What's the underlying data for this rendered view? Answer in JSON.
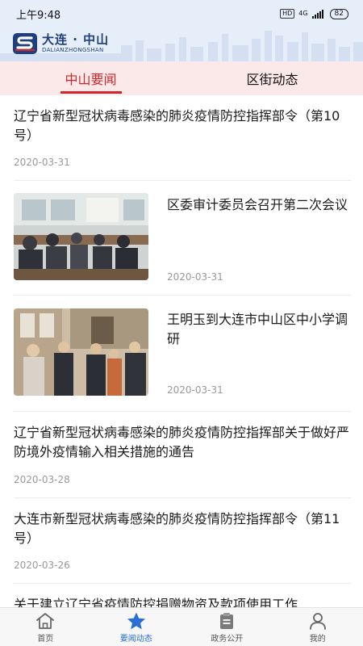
{
  "status_bar": {
    "time": "上午9:48",
    "hd": "HD",
    "network": "4G",
    "battery": "82"
  },
  "header": {
    "logo_title": "大连 · 中山",
    "logo_subtitle": "DALIANZHONGSHAN"
  },
  "tabs": [
    {
      "label": "中山要闻",
      "active": true
    },
    {
      "label": "区街动态",
      "active": false
    }
  ],
  "news": [
    {
      "title": "辽宁省新型冠状病毒感染的肺炎疫情防控指挥部令（第10号）",
      "date": "2020-03-31",
      "has_image": false
    },
    {
      "title": "区委审计委员会召开第二次会议",
      "date": "2020-03-31",
      "has_image": true,
      "image": "meeting-photo"
    },
    {
      "title": "王明玉到大连市中山区中小学调研",
      "date": "2020-03-31",
      "has_image": true,
      "image": "school-visit-photo"
    },
    {
      "title": "辽宁省新型冠状病毒感染的肺炎疫情防控指挥部关于做好严防境外疫情输入相关措施的通告",
      "date": "2020-03-28",
      "has_image": false
    },
    {
      "title": "大连市新型冠状病毒感染的肺炎疫情防控指挥部令（第11号）",
      "date": "2020-03-26",
      "has_image": false
    },
    {
      "title": "关于建立辽宁省疫情防控捐赠物资及款项使用工作",
      "date": "",
      "has_image": false
    }
  ],
  "bottom_nav": [
    {
      "label": "首页",
      "icon": "home-icon",
      "active": false
    },
    {
      "label": "要闻动态",
      "icon": "star-icon",
      "active": true
    },
    {
      "label": "政务公开",
      "icon": "clipboard-icon",
      "active": false
    },
    {
      "label": "我的",
      "icon": "user-icon",
      "active": false
    }
  ],
  "colors": {
    "accent_red": "#d0262a",
    "nav_active_blue": "#2a6fd6",
    "tab_bar_bg": "#fbe9ea",
    "header_bg": "#e6eef9",
    "logo_blue": "#1e3f7c",
    "date_gray": "#999999"
  }
}
